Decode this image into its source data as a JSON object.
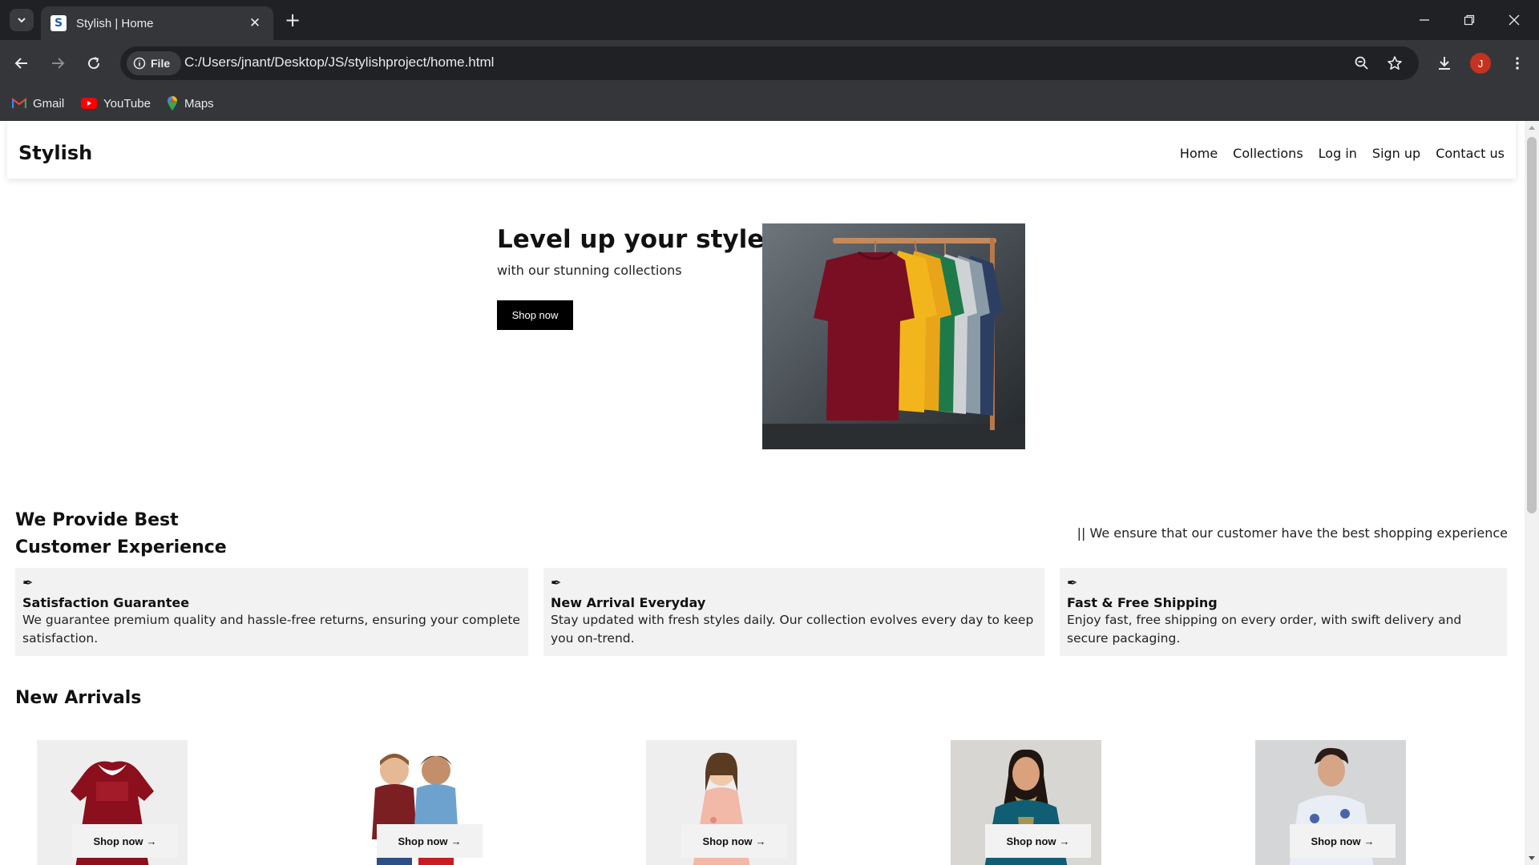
{
  "browser": {
    "tab_title": "Stylish | Home",
    "favicon_letter": "S",
    "site_info_label": "File",
    "url": "C:/Users/jnant/Desktop/JS/stylishproject/home.html",
    "profile_initial": "J",
    "bookmarks": [
      {
        "label": "Gmail",
        "icon": "gmail-icon"
      },
      {
        "label": "YouTube",
        "icon": "youtube-icon"
      },
      {
        "label": "Maps",
        "icon": "maps-icon"
      }
    ]
  },
  "site": {
    "brand": "Stylish",
    "nav": [
      "Home",
      "Collections",
      "Log in",
      "Sign up",
      "Contact us"
    ]
  },
  "hero": {
    "title": "Level up your style",
    "subtitle": "with our stunning collections",
    "button": "Shop now",
    "image": "t-shirts-on-rack"
  },
  "experience": {
    "title_line1": "We Provide Best",
    "title_line2": "Customer Experience",
    "tagline": "|| We ensure that our customer have the best shopping experience",
    "features": [
      {
        "icon": "feather-icon",
        "title": "Satisfaction Guarantee",
        "desc": "We guarantee premium quality and hassle-free returns, ensuring your complete satisfaction."
      },
      {
        "icon": "feather-icon",
        "title": "New Arrival Everyday",
        "desc": "Stay updated with fresh styles daily. Our collection evolves every day to keep you on-trend."
      },
      {
        "icon": "feather-icon",
        "title": "Fast & Free Shipping",
        "desc": "Enjoy fast, free shipping on every order, with swift delivery and secure packaging."
      }
    ]
  },
  "arrivals": {
    "title": "New Arrivals",
    "products": [
      {
        "image": "red-baby-dress",
        "button": "Shop now"
      },
      {
        "image": "two-kids",
        "button": "Shop now"
      },
      {
        "image": "girl-floral-dress",
        "button": "Shop now"
      },
      {
        "image": "woman-teal-kurta",
        "button": "Shop now"
      },
      {
        "image": "man-floral-shirt",
        "button": "Shop now"
      }
    ]
  },
  "colors": {
    "chrome_dark": "#202124",
    "chrome_mid": "#35363a",
    "accent_black": "#000000",
    "card_bg": "#f2f2f2",
    "avatar": "#c5321f"
  }
}
